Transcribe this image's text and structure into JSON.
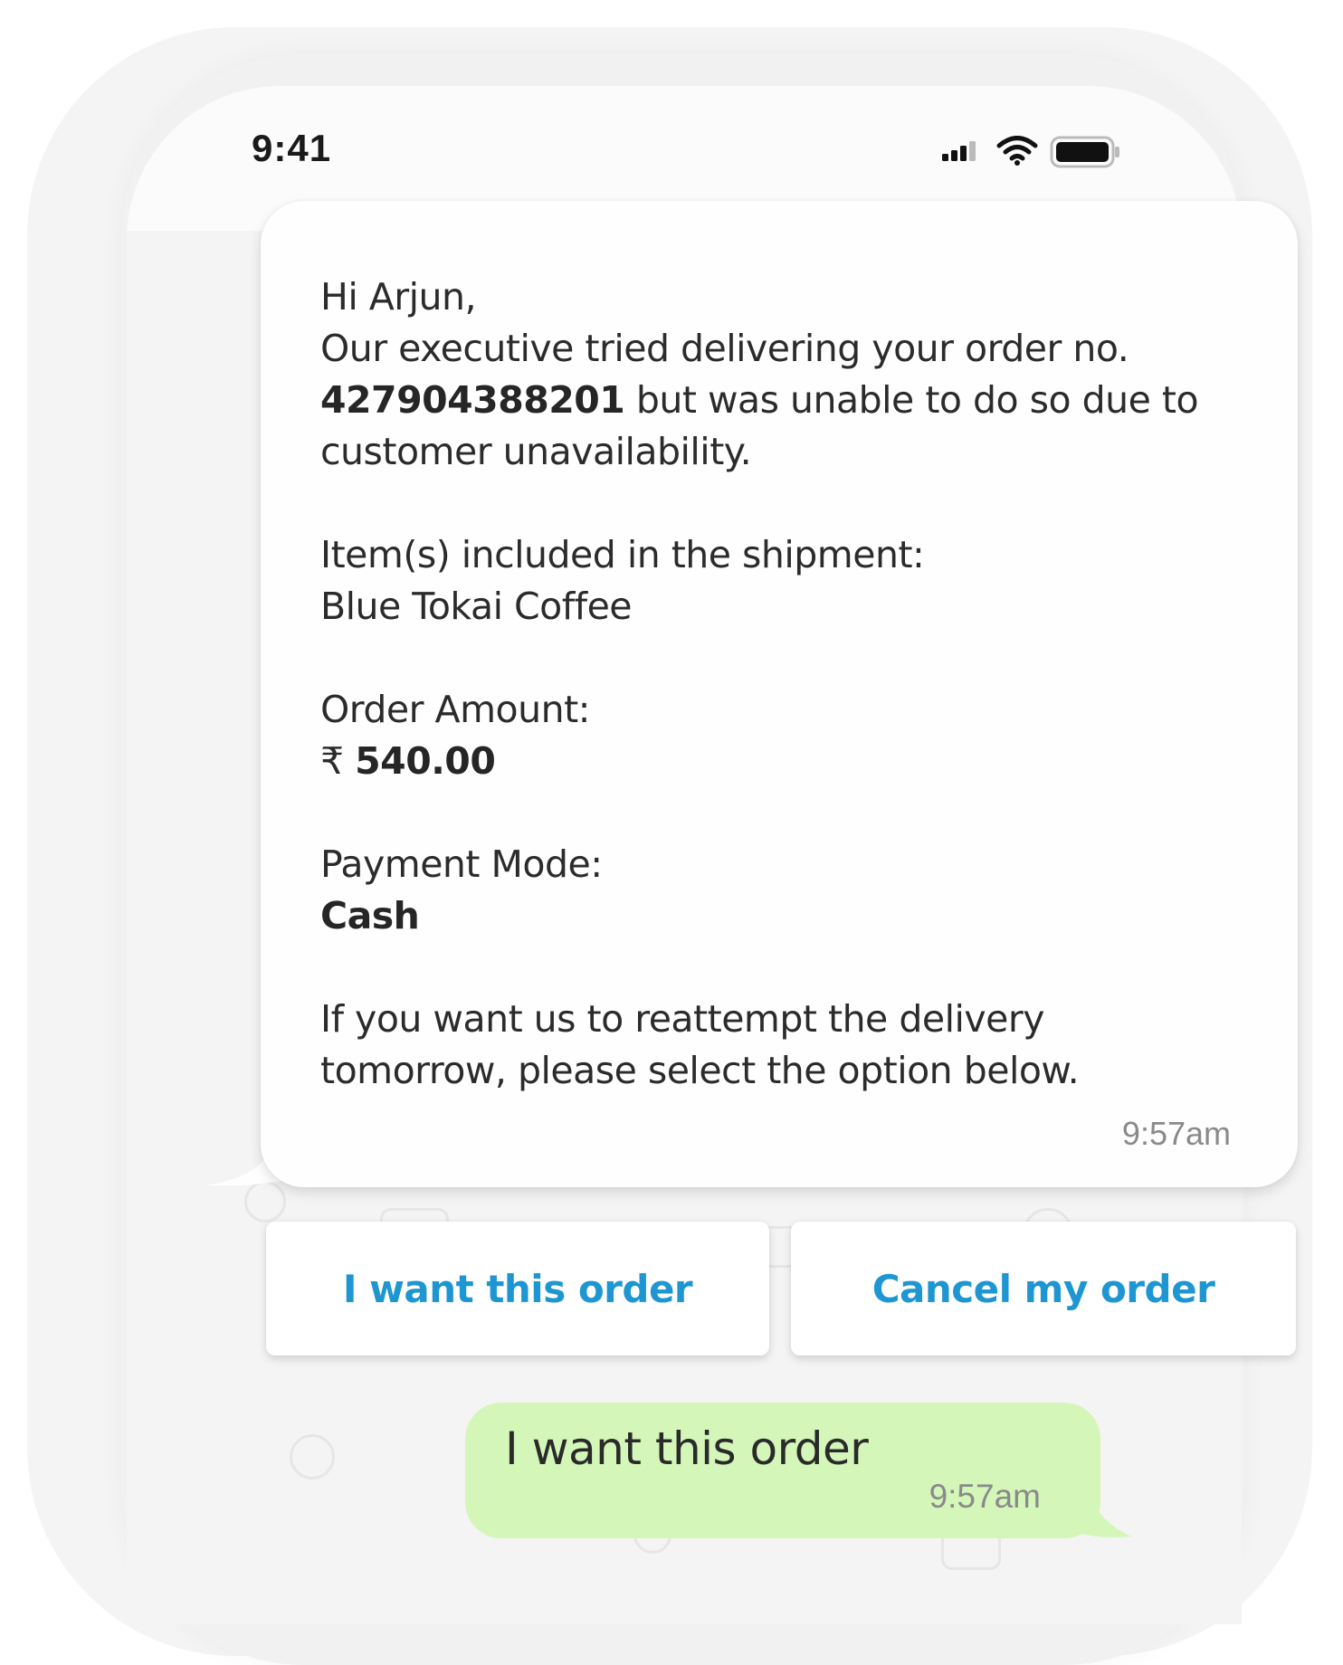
{
  "status_bar": {
    "time": "9:41",
    "icons": [
      "signal-icon",
      "wifi-icon",
      "battery-icon"
    ]
  },
  "incoming_message": {
    "greeting": "Hi Arjun,",
    "line_intro": "Our executive tried delivering your order no.",
    "order_number": "427904388201",
    "line_after_order": " but was unable to do so due to",
    "line_reason": "customer unavailability.",
    "items_label": "Item(s) included in the shipment:",
    "items_value": "Blue Tokai Coffee",
    "amount_label": "Order Amount:",
    "currency_symbol": "₹",
    "amount_value": "540.00",
    "payment_label": "Payment Mode:",
    "payment_value": "Cash",
    "closing_line1": "If you want us to reattempt the delivery",
    "closing_line2": "tomorrow, please select the option below.",
    "time": "9:57am"
  },
  "quick_replies": {
    "want_order": "I want this order",
    "cancel_order": "Cancel my order"
  },
  "outgoing_message": {
    "text": "I want this order",
    "time": "9:57am"
  },
  "colors": {
    "button_text": "#1e96d2",
    "outgoing_bubble": "#d4f7b9",
    "incoming_bubble": "#fefefe"
  }
}
